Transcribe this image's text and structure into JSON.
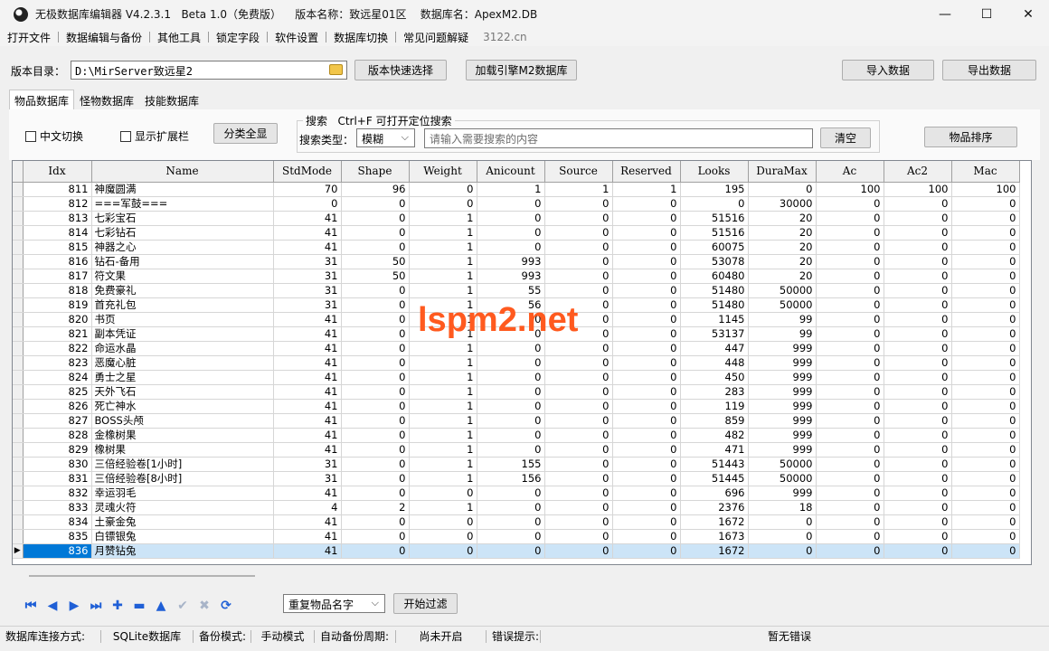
{
  "window": {
    "title": "无极数据库编辑器 V4.2.3.1   Beta 1.0（免费版）    版本名称：致远星01区    数据库名：ApexM2.DB",
    "minimize": "—",
    "maximize": "☐",
    "close": "✕"
  },
  "menu": [
    "打开文件",
    "数据编辑与备份",
    "其他工具",
    "锁定字段",
    "软件设置",
    "数据库切换",
    "常见问题解疑"
  ],
  "menu_link": "3122.cn",
  "toolbar": {
    "dir_label": "版本目录：",
    "dir_value": "D:\\MirServer致远星2",
    "quick_select": "版本快速选择",
    "load_engine": "加载引擎M2数据库",
    "import": "导入数据",
    "export": "导出数据"
  },
  "tabs": [
    "物品数据库",
    "怪物数据库",
    "技能数据库"
  ],
  "filter": {
    "chinese_toggle": "中文切换",
    "show_ext": "显示扩展栏",
    "classify_all": "分类全显",
    "search_title": "搜索   Ctrl+F 可打开定位搜索",
    "search_type_label": "搜索类型：",
    "search_type": "模糊",
    "search_placeholder": "请输入需要搜索的内容",
    "clear": "清空",
    "sort": "物品排序"
  },
  "grid": {
    "columns": [
      "Idx",
      "Name",
      "StdMode",
      "Shape",
      "Weight",
      "Anicount",
      "Source",
      "Reserved",
      "Looks",
      "DuraMax",
      "Ac",
      "Ac2",
      "Mac"
    ],
    "selected_idx": 836,
    "rows": [
      [
        811,
        "神魔圆满",
        70,
        96,
        0,
        1,
        1,
        1,
        195,
        0,
        100,
        100,
        100
      ],
      [
        812,
        "===军鼓===",
        0,
        0,
        0,
        0,
        0,
        0,
        0,
        30000,
        0,
        0,
        0
      ],
      [
        813,
        "七彩宝石",
        41,
        0,
        1,
        0,
        0,
        0,
        51516,
        20,
        0,
        0,
        0
      ],
      [
        814,
        "七彩钻石",
        41,
        0,
        1,
        0,
        0,
        0,
        51516,
        20,
        0,
        0,
        0
      ],
      [
        815,
        "神器之心",
        41,
        0,
        1,
        0,
        0,
        0,
        60075,
        20,
        0,
        0,
        0
      ],
      [
        816,
        "钻石-备用",
        31,
        50,
        1,
        993,
        0,
        0,
        53078,
        20,
        0,
        0,
        0
      ],
      [
        817,
        "符文果",
        31,
        50,
        1,
        993,
        0,
        0,
        60480,
        20,
        0,
        0,
        0
      ],
      [
        818,
        "免费豪礼",
        31,
        0,
        1,
        55,
        0,
        0,
        51480,
        50000,
        0,
        0,
        0
      ],
      [
        819,
        "首充礼包",
        31,
        0,
        1,
        56,
        0,
        0,
        51480,
        50000,
        0,
        0,
        0
      ],
      [
        820,
        "书页",
        41,
        0,
        1,
        0,
        0,
        0,
        1145,
        99,
        0,
        0,
        0
      ],
      [
        821,
        "副本凭证",
        41,
        0,
        1,
        0,
        0,
        0,
        53137,
        99,
        0,
        0,
        0
      ],
      [
        822,
        "命运水晶",
        41,
        0,
        1,
        0,
        0,
        0,
        447,
        999,
        0,
        0,
        0
      ],
      [
        823,
        "恶魔心脏",
        41,
        0,
        1,
        0,
        0,
        0,
        448,
        999,
        0,
        0,
        0
      ],
      [
        824,
        "勇士之星",
        41,
        0,
        1,
        0,
        0,
        0,
        450,
        999,
        0,
        0,
        0
      ],
      [
        825,
        "天外飞石",
        41,
        0,
        1,
        0,
        0,
        0,
        283,
        999,
        0,
        0,
        0
      ],
      [
        826,
        "死亡神水",
        41,
        0,
        1,
        0,
        0,
        0,
        119,
        999,
        0,
        0,
        0
      ],
      [
        827,
        "BOSS头颅",
        41,
        0,
        1,
        0,
        0,
        0,
        859,
        999,
        0,
        0,
        0
      ],
      [
        828,
        "金橡树果",
        41,
        0,
        1,
        0,
        0,
        0,
        482,
        999,
        0,
        0,
        0
      ],
      [
        829,
        "橡树果",
        41,
        0,
        1,
        0,
        0,
        0,
        471,
        999,
        0,
        0,
        0
      ],
      [
        830,
        "三倍经验卷[1小时]",
        31,
        0,
        1,
        155,
        0,
        0,
        51443,
        50000,
        0,
        0,
        0
      ],
      [
        831,
        "三倍经验卷[8小时]",
        31,
        0,
        1,
        156,
        0,
        0,
        51445,
        50000,
        0,
        0,
        0
      ],
      [
        832,
        "幸运羽毛",
        41,
        0,
        0,
        0,
        0,
        0,
        696,
        999,
        0,
        0,
        0
      ],
      [
        833,
        "灵魂火符",
        4,
        2,
        1,
        0,
        0,
        0,
        2376,
        18,
        0,
        0,
        0
      ],
      [
        834,
        "土豪金兔",
        41,
        0,
        0,
        0,
        0,
        0,
        1672,
        0,
        0,
        0,
        0
      ],
      [
        835,
        "白镖银兔",
        41,
        0,
        0,
        0,
        0,
        0,
        1673,
        0,
        0,
        0,
        0
      ],
      [
        836,
        "月赞钻兔",
        41,
        0,
        0,
        0,
        0,
        0,
        1672,
        0,
        0,
        0,
        0
      ]
    ]
  },
  "watermark": "lspm2.net",
  "bottom": {
    "dup_filter": "重复物品名字",
    "start_filter": "开始过滤"
  },
  "status": {
    "conn_label": "数据库连接方式:",
    "conn_value": "SQLite数据库",
    "backup_label": "备份模式:",
    "backup_value": "手动模式",
    "auto_label": "自动备份周期:",
    "auto_value": "尚未开启",
    "err_label": "错误提示:",
    "err_value": "暂无错误"
  }
}
